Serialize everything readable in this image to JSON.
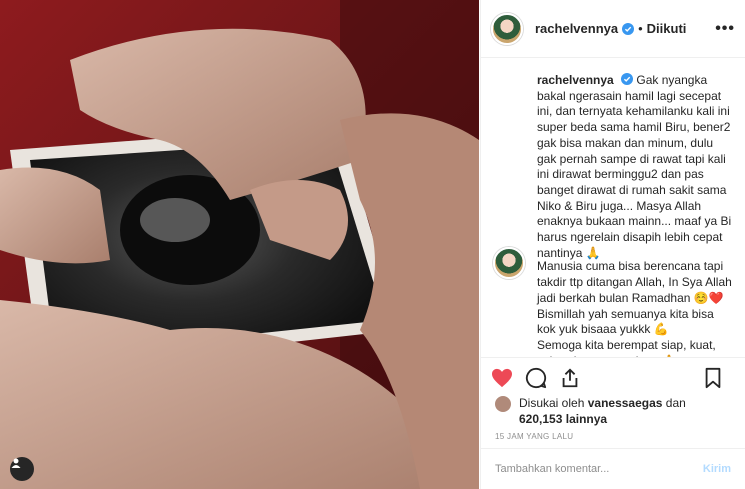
{
  "post": {
    "username": "rachelvennya",
    "follow_status": "Diikuti",
    "more": "•••",
    "dot": "•"
  },
  "caption": {
    "username": "rachelvennya",
    "text_1": "Gak nyangka bakal ngerasain hamil lagi secepat ini, dan ternyata kehamilanku kali ini super beda sama hamil Biru, bener2 gak bisa makan dan minum, dulu gak pernah sampe di rawat tapi kali ini dirawat berminggu2 dan pas banget dirawat di rumah sakit sama Niko & Biru juga... Masya Allah enaknya bukaan mainn... maaf ya Bi harus ngerelain disapih lebih cepat nantinya",
    "emoji_1": "🙏",
    "text_2": "Manusia cuma bisa berencana tapi takdir ttp ditangan Allah, In Sya Allah jadi berkah bulan Ramadhan ☺️❤️",
    "text_3": "Bismillah yah semuanya kita bisa kok yuk bisaaa yukkk 💪",
    "text_4": "Semoga kita berempat siap, kuat, sehat dan terus sejaaa 🙏 see you lil"
  },
  "likes": {
    "prefix": "Disukai oleh",
    "user": "vanessaegas",
    "and": "dan",
    "count": "620,153",
    "suffix": "lainnya"
  },
  "time": "15 JAM YANG LALU",
  "comment_box": {
    "placeholder": "Tambahkan komentar...",
    "post_label": "Kirim"
  },
  "colors": {
    "like_red": "#ed4956",
    "verified_blue": "#3897f0",
    "post_disabled": "#b3dbff"
  }
}
